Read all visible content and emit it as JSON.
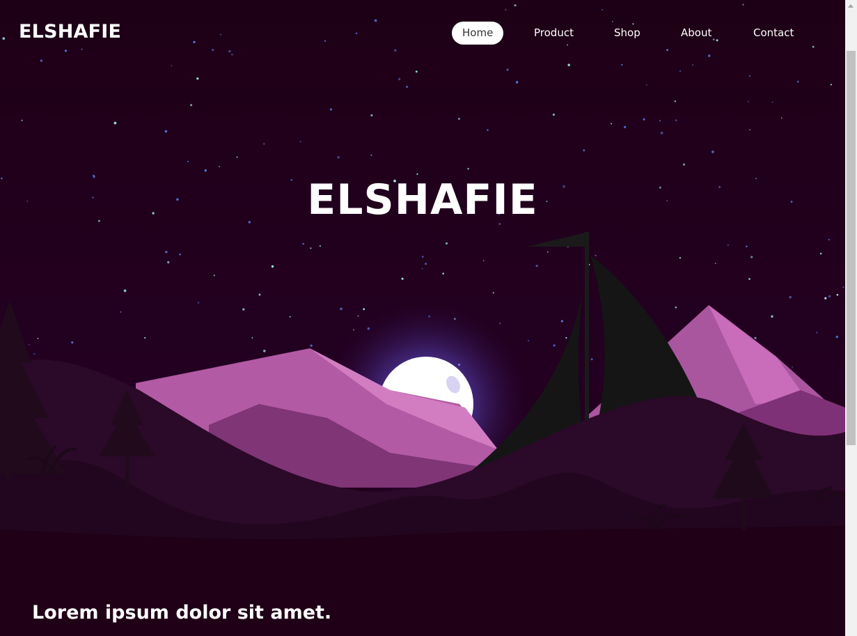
{
  "brand": {
    "logo": "ELSHAFIE"
  },
  "nav": {
    "items": [
      {
        "label": "Home",
        "active": true
      },
      {
        "label": "Product",
        "active": false
      },
      {
        "label": "Shop",
        "active": false
      },
      {
        "label": "About",
        "active": false
      },
      {
        "label": "Contact",
        "active": false
      }
    ]
  },
  "hero": {
    "title": "ELSHAFIE",
    "tagline": "Lorem ipsum dolor sit amet."
  },
  "colors": {
    "sky": "#1f0016",
    "mountain": "#b35aa4",
    "moon": "#ffffff",
    "sail": "#151515"
  }
}
